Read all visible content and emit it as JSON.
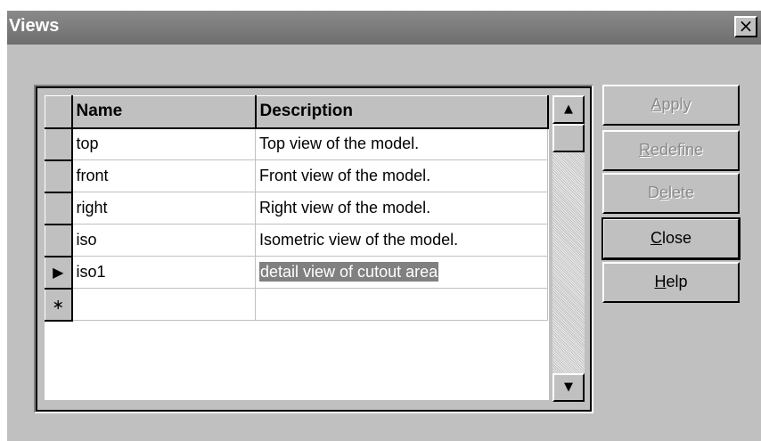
{
  "window": {
    "title": "Views",
    "close_label": "×"
  },
  "grid": {
    "columns": [
      "Name",
      "Description"
    ],
    "rows": [
      {
        "marker": "",
        "name": "top",
        "description": "Top view of the model."
      },
      {
        "marker": "",
        "name": "front",
        "description": "Front view of the model."
      },
      {
        "marker": "",
        "name": "right",
        "description": "Right view of the model."
      },
      {
        "marker": "",
        "name": "iso",
        "description": "Isometric view of the model."
      },
      {
        "marker": "▶",
        "name": "iso1",
        "description": "detail view of cutout area"
      },
      {
        "marker": "∗",
        "name": "",
        "description": ""
      }
    ],
    "current_row": 4,
    "new_row": 5
  },
  "scrollbar": {
    "up_icon": "▲",
    "down_icon": "▼"
  },
  "buttons": {
    "apply": {
      "label": "Apply",
      "mnemonic": "A",
      "rest": "pply",
      "enabled": false
    },
    "redefine": {
      "label": "Redefine",
      "mnemonic": "R",
      "rest": "edefine",
      "enabled": false
    },
    "delete": {
      "label": "Delete",
      "pre": "D",
      "mnemonic": "e",
      "rest": "lete",
      "enabled": false
    },
    "close": {
      "label": "Close",
      "mnemonic": "C",
      "rest": "lose",
      "enabled": true
    },
    "help": {
      "label": "Help",
      "mnemonic": "H",
      "rest": "elp",
      "enabled": true
    }
  }
}
